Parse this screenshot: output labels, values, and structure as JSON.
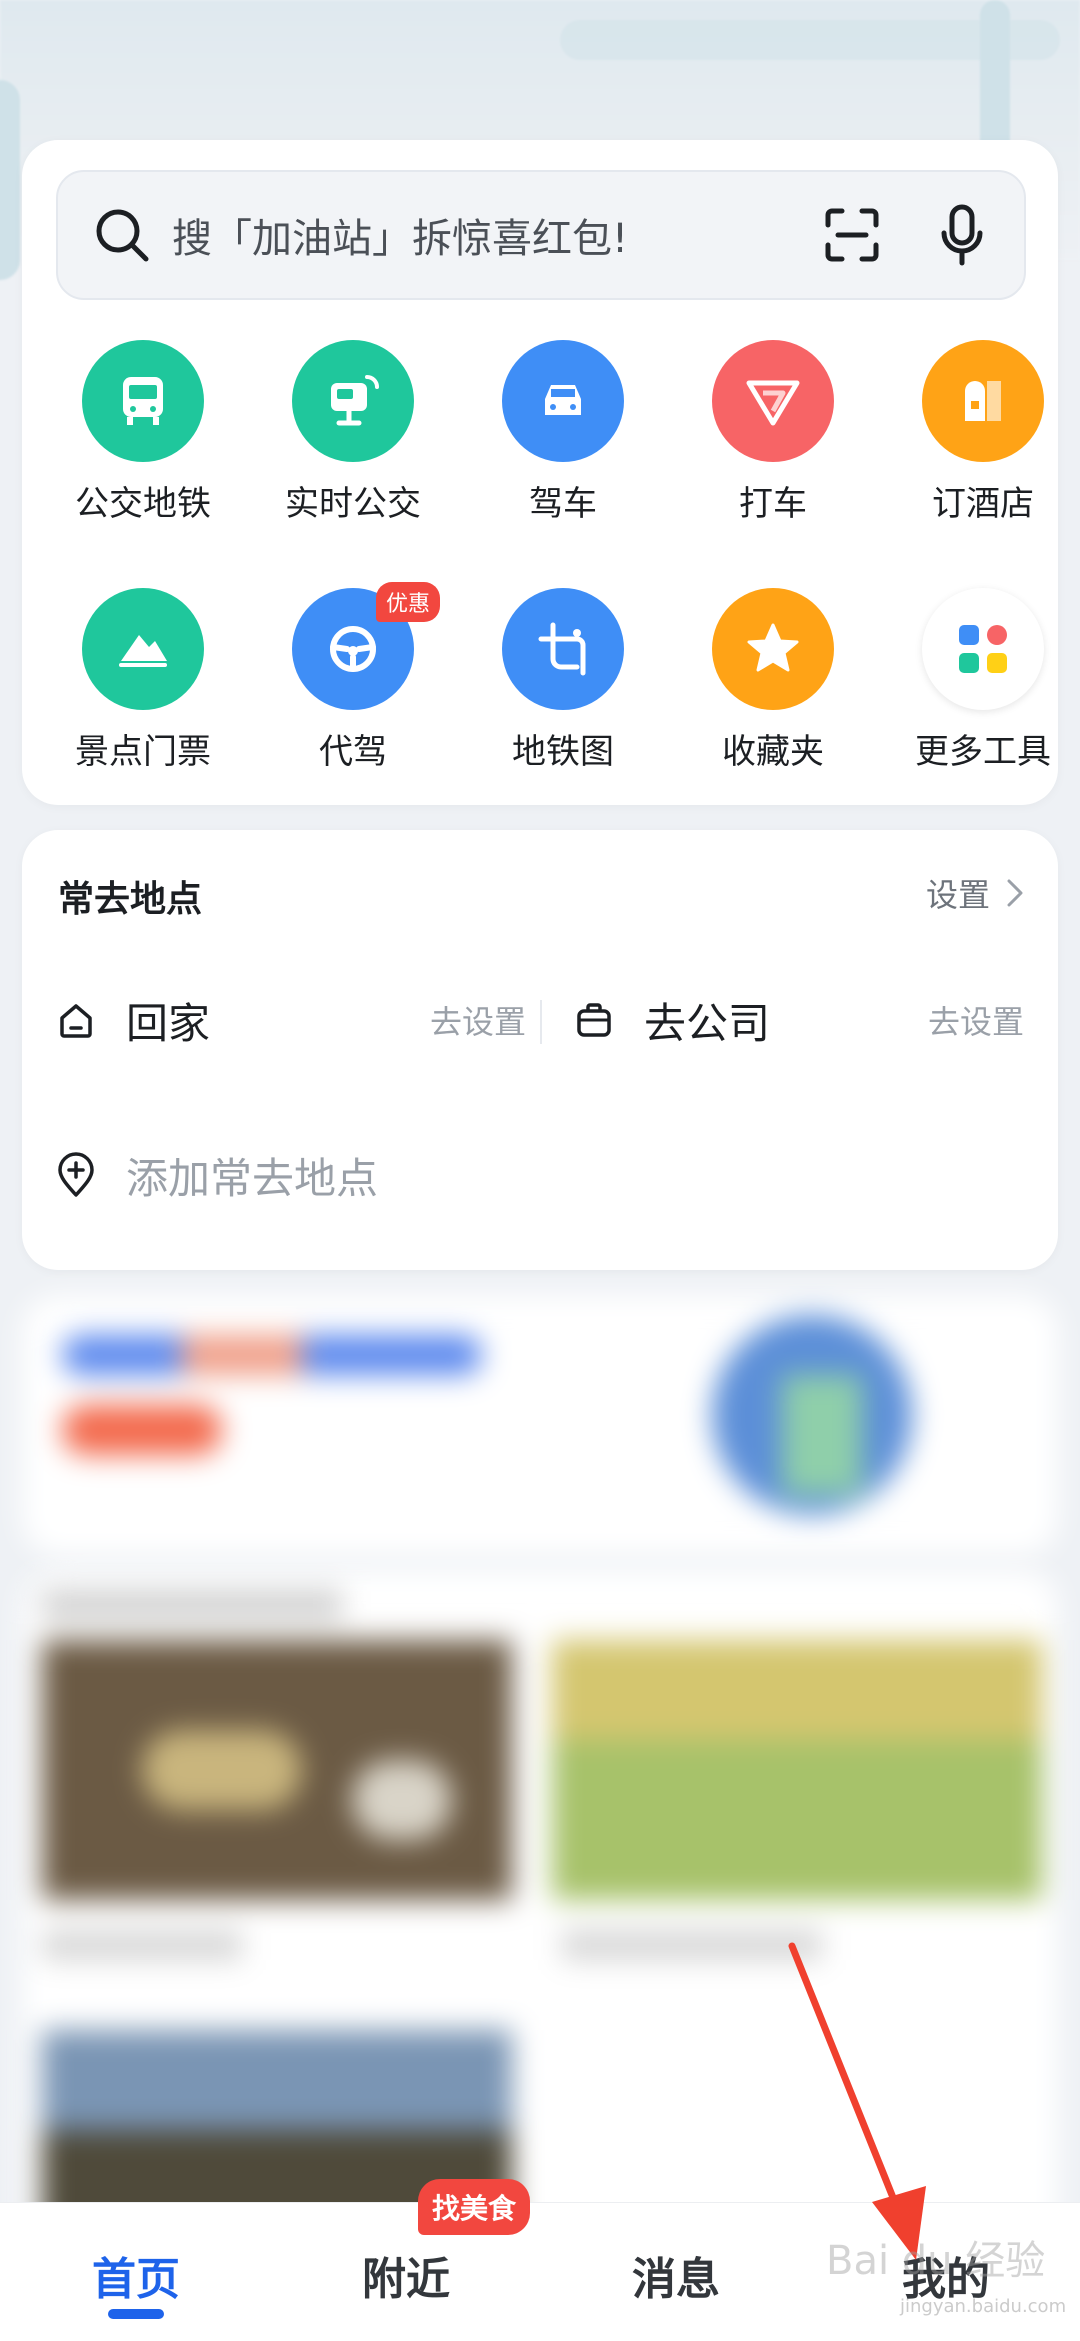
{
  "search": {
    "placeholder": "搜「加油站」拆惊喜红包!"
  },
  "tools": [
    {
      "label": "公交地铁",
      "icon": "bus-icon",
      "color": "#1fc79c"
    },
    {
      "label": "实时公交",
      "icon": "realtime-bus-icon",
      "color": "#1fc79c"
    },
    {
      "label": "驾车",
      "icon": "car-icon",
      "color": "#3f8ef6"
    },
    {
      "label": "打车",
      "icon": "taxi-icon",
      "color": "#f76466"
    },
    {
      "label": "订酒店",
      "icon": "hotel-icon",
      "color": "#ffa316"
    },
    {
      "label": "景点门票",
      "icon": "scenic-ticket-icon",
      "color": "#1fc79c"
    },
    {
      "label": "代驾",
      "icon": "steering-wheel-icon",
      "color": "#3f8ef6",
      "badge": "优惠"
    },
    {
      "label": "地铁图",
      "icon": "subway-map-icon",
      "color": "#3f8ef6"
    },
    {
      "label": "收藏夹",
      "icon": "star-icon",
      "color": "#ffa316"
    },
    {
      "label": "更多工具",
      "icon": "more-tools-icon",
      "color": "#ffffff"
    }
  ],
  "places": {
    "title": "常去地点",
    "settings_label": "设置",
    "home": {
      "label": "回家",
      "action": "去设置"
    },
    "work": {
      "label": "去公司",
      "action": "去设置"
    },
    "add_label": "添加常去地点"
  },
  "tabbar": {
    "tabs": [
      "首页",
      "附近",
      "消息",
      "我的"
    ],
    "active": "首页",
    "nearby_badge": "找美食"
  },
  "watermark": {
    "text": "Bai du 经验",
    "sub": "jingyan.baidu.com"
  },
  "colors": {
    "accent": "#1e63ea",
    "badge": "#f2473f",
    "arrow": "#f0402e"
  }
}
